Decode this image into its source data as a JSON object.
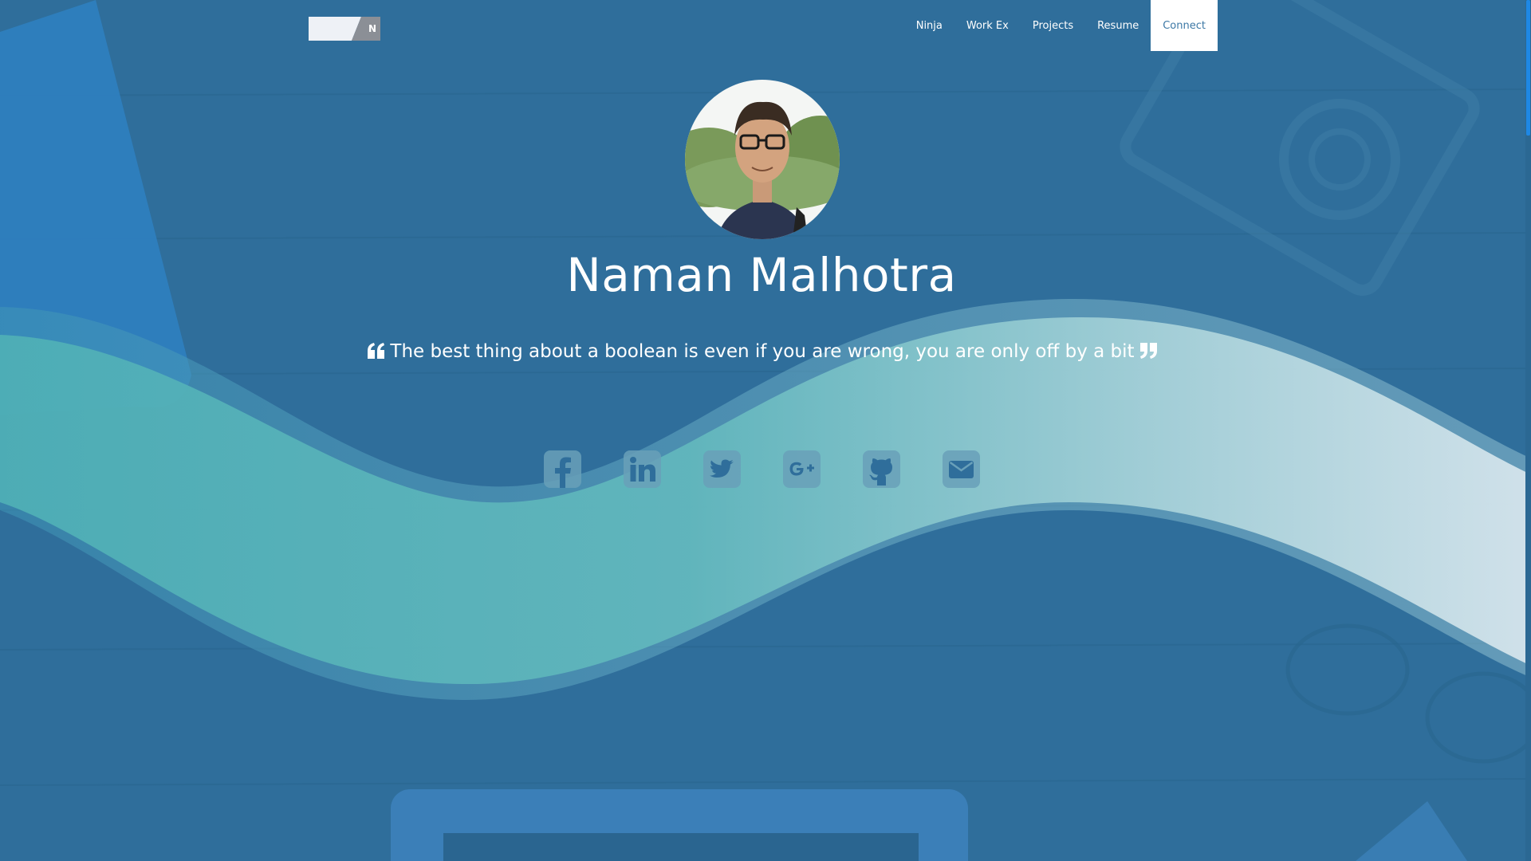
{
  "nav": {
    "logo_letter": "N",
    "items": [
      {
        "label": "Ninja"
      },
      {
        "label": "Work Ex"
      },
      {
        "label": "Projects"
      },
      {
        "label": "Resume"
      },
      {
        "label": "Connect",
        "active": true
      }
    ]
  },
  "profile": {
    "name": "Naman Malhotra",
    "quote": "The best thing about a boolean is even if you are wrong, you are only off by a bit"
  },
  "social": [
    {
      "icon": "facebook-icon"
    },
    {
      "icon": "linkedin-icon"
    },
    {
      "icon": "twitter-icon"
    },
    {
      "icon": "google-plus-icon"
    },
    {
      "icon": "github-icon"
    },
    {
      "icon": "envelope-icon"
    }
  ],
  "colors": {
    "background": "#2f6e9b",
    "wave_teal": "#5bb4b9",
    "wave_light": "#cfe3ea",
    "icon_tile": "#69a0b9",
    "active_nav_text": "#3c78a5",
    "scroll_thumb": "#1e88e5"
  }
}
